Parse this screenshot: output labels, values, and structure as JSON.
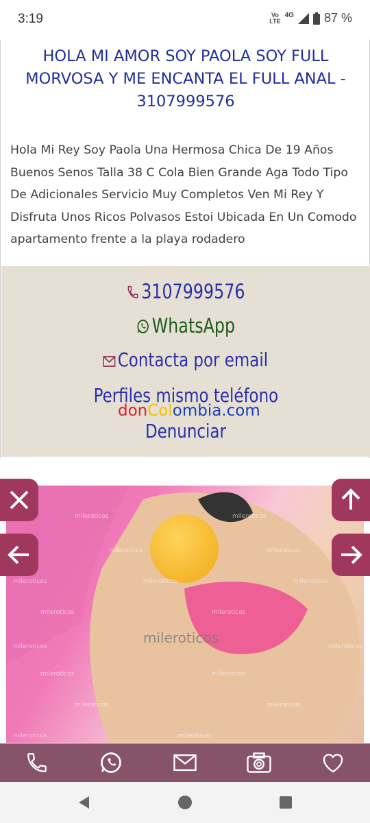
{
  "status_bar": {
    "time": "3:19",
    "network_top": "Vo",
    "network_bottom": "LTE",
    "network_type": "4G",
    "battery": "87 %"
  },
  "ad": {
    "title": "HOLA MI AMOR SOY PAOLA SOY FULL MORVOSA Y ME ENCANTA EL FULL ANAL - 3107999576",
    "description": "Hola Mi Rey Soy Paola Una Hermosa Chica De 19 Años Buenos Senos Talla 38 C Cola Bien Grande Aga Todo Tipo De Adicionales Servicio Muy Completos Ven Mi Rey Y Disfruta Unos Ricos Polvasos Estoi Ubicada En Un Comodo apartamento frente a la playa rodadero"
  },
  "contact": {
    "phone": "3107999576",
    "whatsapp": "WhatsApp",
    "email": "Contacta por email",
    "perfiles": "Perfiles mismo teléfono",
    "denunciar": "Denunciar"
  },
  "watermark": {
    "part1": "don",
    "part2": "Col",
    "part3": "ombia.com"
  },
  "photo": {
    "watermark_text": "mileroticos",
    "center_watermark": "mileroticos"
  },
  "icons": {
    "close": "close-icon",
    "up": "arrow-up-icon",
    "left": "arrow-left-icon",
    "right": "arrow-right-icon",
    "phone": "phone-icon",
    "whatsapp": "whatsapp-icon",
    "mail": "mail-icon",
    "camera": "camera-icon",
    "heart": "heart-icon"
  },
  "colors": {
    "title": "#1f2f9e",
    "contact_bg": "#e6e0d4",
    "whatsapp": "#1c5b1c",
    "accent": "#a0385e",
    "bottom_bar": "#86536a"
  }
}
